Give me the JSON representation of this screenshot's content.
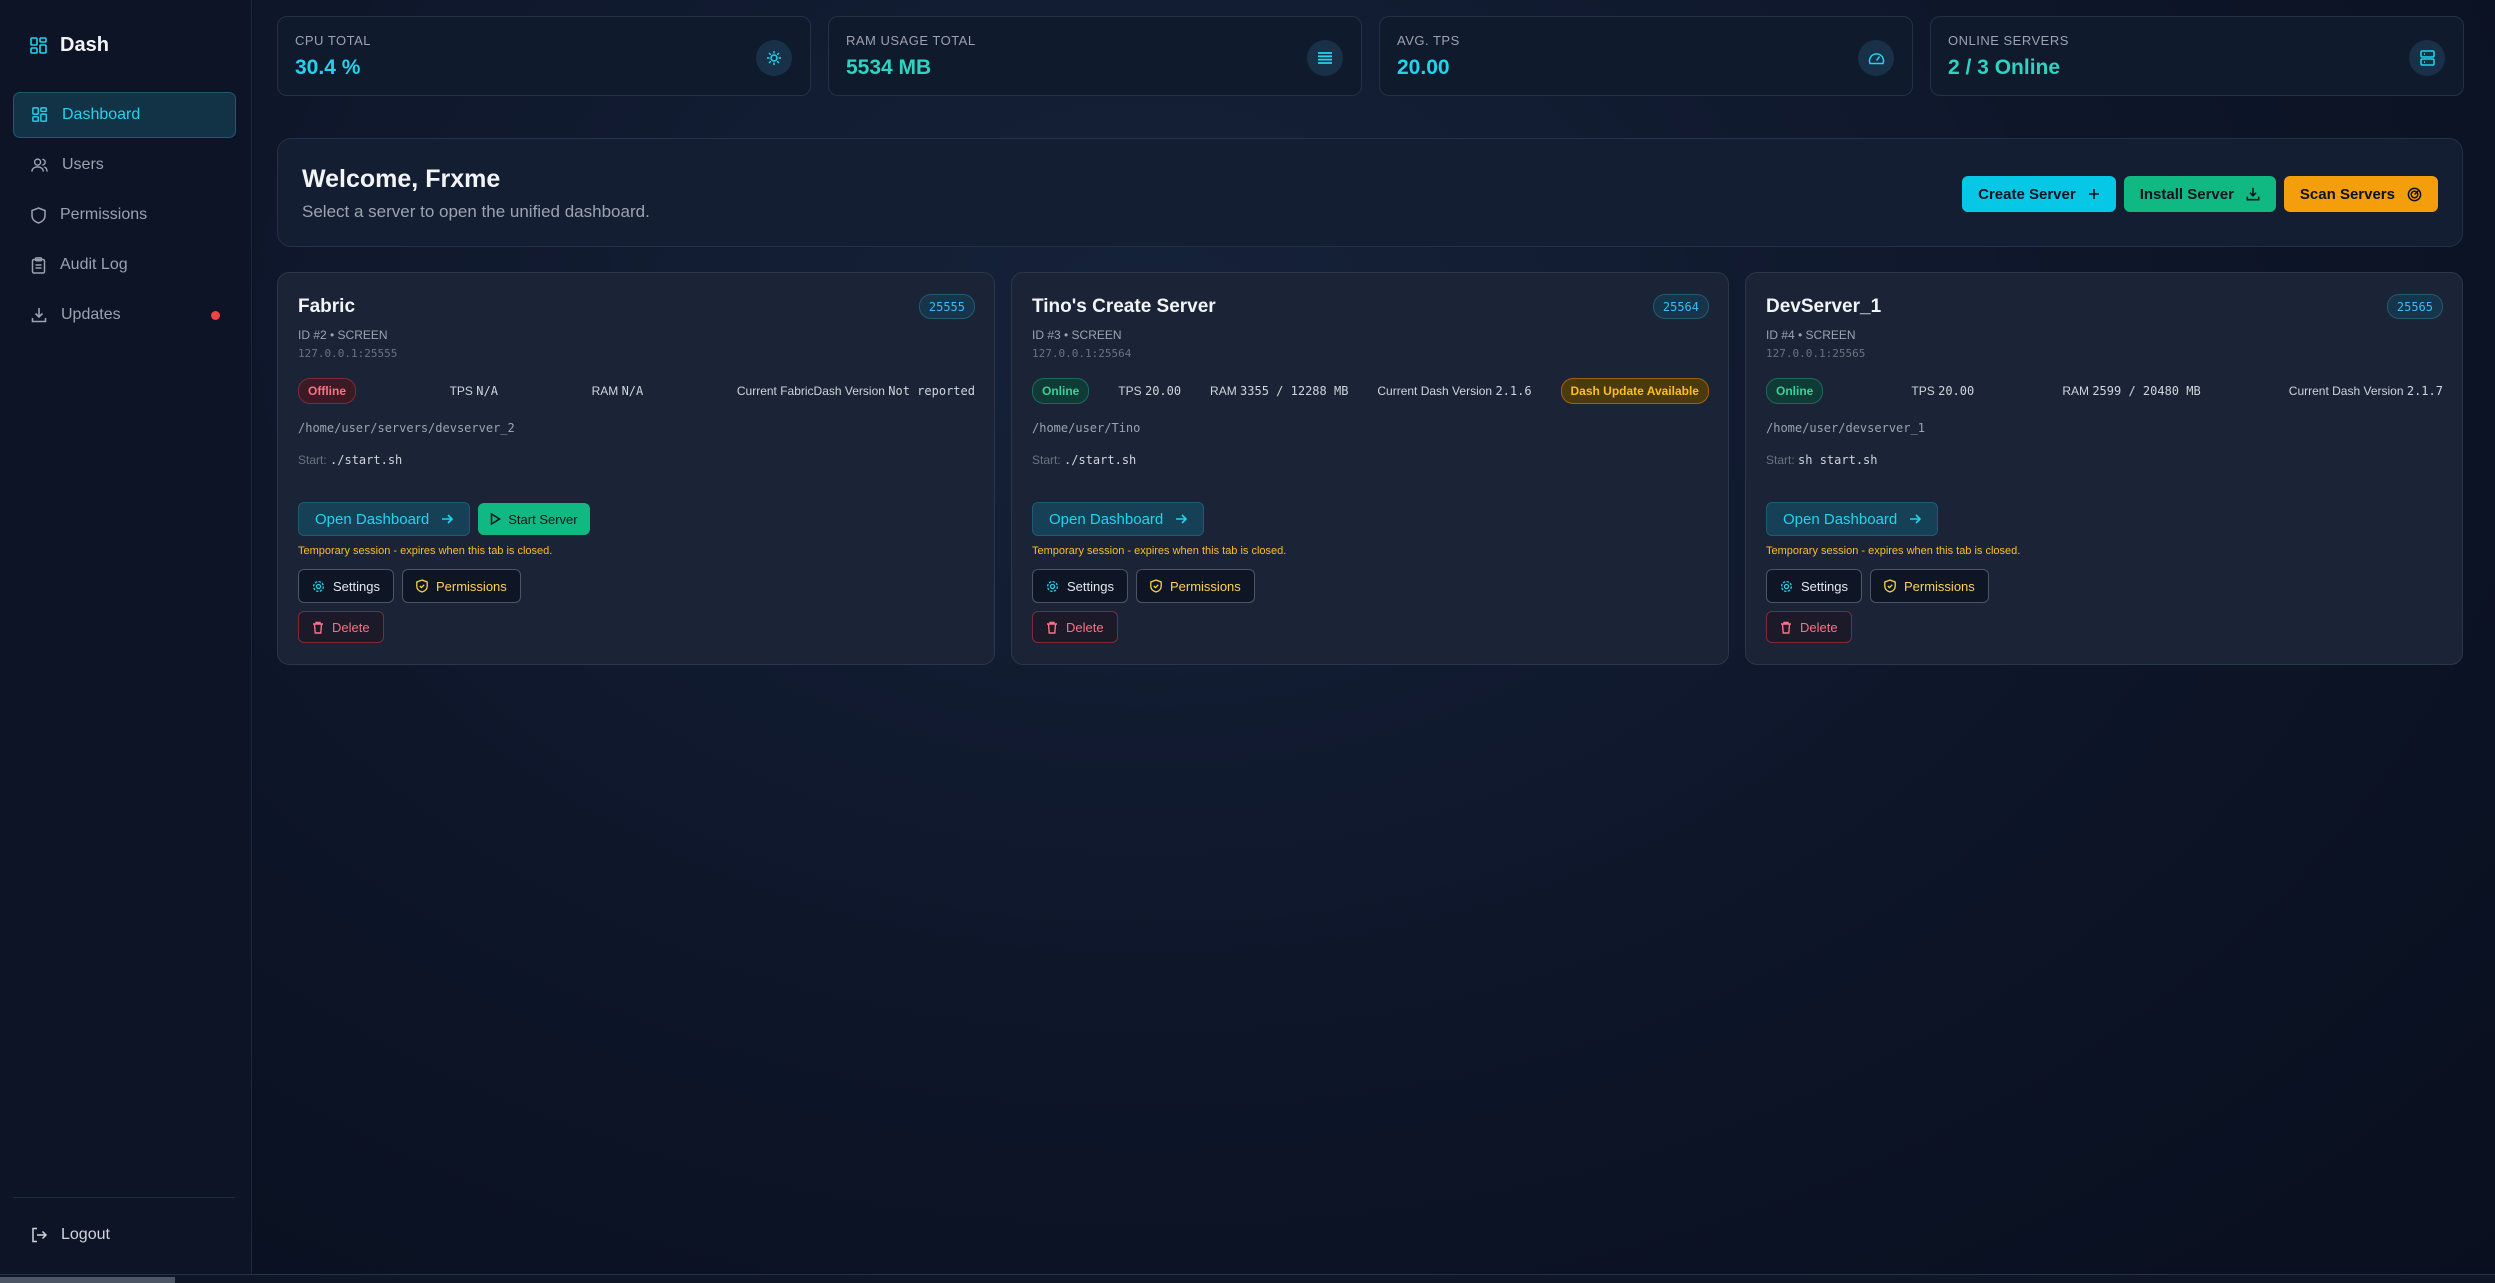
{
  "sidebar": {
    "brand": "Dash",
    "items": [
      {
        "label": "Dashboard",
        "icon": "dashboard-icon",
        "active": true
      },
      {
        "label": "Users",
        "icon": "users-icon"
      },
      {
        "label": "Permissions",
        "icon": "shield-icon"
      },
      {
        "label": "Audit Log",
        "icon": "clipboard-icon"
      },
      {
        "label": "Updates",
        "icon": "download-icon",
        "notification": true
      }
    ],
    "logout": "Logout"
  },
  "stats": [
    {
      "label": "CPU TOTAL",
      "value": "30.4 %",
      "icon": "cpu-icon"
    },
    {
      "label": "RAM USAGE TOTAL",
      "value": "5534 MB",
      "icon": "list-icon"
    },
    {
      "label": "AVG. TPS",
      "value": "20.00",
      "icon": "gauge-icon"
    },
    {
      "label": "ONLINE SERVERS",
      "value": "2 / 3 Online",
      "icon": "server-icon"
    }
  ],
  "welcome": {
    "title": "Welcome, Frxme",
    "subtitle": "Select a server to open the unified dashboard.",
    "create_label": "Create Server",
    "install_label": "Install Server",
    "scan_label": "Scan Servers"
  },
  "servers": [
    {
      "name": "Fabric",
      "port": "25555",
      "meta": "ID #2 • SCREEN",
      "address": "127.0.0.1:25555",
      "status": "Offline",
      "tps_label": "TPS",
      "tps": "N/A",
      "ram_label": "RAM",
      "ram": "N/A",
      "version_label": "Current FabricDash Version",
      "version": "Not reported",
      "path": "/home/user/servers/devserver_2",
      "start_label": "Start:",
      "start_cmd": "./start.sh",
      "open_label": "Open Dashboard",
      "start_server_label": "Start Server",
      "temp_note": "Temporary session - expires when this tab is closed.",
      "settings_label": "Settings",
      "permissions_label": "Permissions",
      "delete_label": "Delete"
    },
    {
      "name": "Tino's Create Server",
      "port": "25564",
      "meta": "ID #3 • SCREEN",
      "address": "127.0.0.1:25564",
      "status": "Online",
      "tps_label": "TPS",
      "tps": "20.00",
      "ram_label": "RAM",
      "ram": "3355 / 12288 MB",
      "version_label": "Current Dash Version",
      "version": "2.1.6",
      "update_badge": "Dash Update Available",
      "path": "/home/user/Tino",
      "start_label": "Start:",
      "start_cmd": "./start.sh",
      "open_label": "Open Dashboard",
      "temp_note": "Temporary session - expires when this tab is closed.",
      "settings_label": "Settings",
      "permissions_label": "Permissions",
      "delete_label": "Delete"
    },
    {
      "name": "DevServer_1",
      "port": "25565",
      "meta": "ID #4 • SCREEN",
      "address": "127.0.0.1:25565",
      "status": "Online",
      "tps_label": "TPS",
      "tps": "20.00",
      "ram_label": "RAM",
      "ram": "2599 / 20480 MB",
      "version_label": "Current Dash Version",
      "version": "2.1.7",
      "path": "/home/user/devserver_1",
      "start_label": "Start:",
      "start_cmd": "sh start.sh",
      "open_label": "Open Dashboard",
      "temp_note": "Temporary session - expires when this tab is closed.",
      "settings_label": "Settings",
      "permissions_label": "Permissions",
      "delete_label": "Delete"
    }
  ],
  "colors": {
    "accent_cyan": "#22d3ee",
    "accent_green": "#10b981",
    "accent_orange": "#f59e0b",
    "danger": "#fb7185",
    "background": "#0a1020"
  }
}
